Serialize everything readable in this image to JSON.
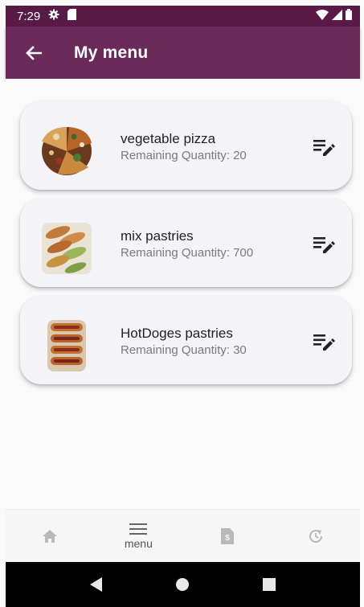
{
  "status_bar": {
    "time": "7:29"
  },
  "app_bar": {
    "title": "My menu"
  },
  "menu_items": [
    {
      "name": "vegetable pizza",
      "remaining": "Remaining Quantity: 20"
    },
    {
      "name": "mix pastries",
      "remaining": "Remaining Quantity: 700"
    },
    {
      "name": "HotDoges pastries",
      "remaining": "Remaining Quantity: 30"
    }
  ],
  "bottom_nav": {
    "items": [
      {
        "icon": "home-icon",
        "label": ""
      },
      {
        "icon": "menu-icon",
        "label": "menu"
      },
      {
        "icon": "invoice-icon",
        "label": ""
      },
      {
        "icon": "history-icon",
        "label": ""
      }
    ]
  },
  "colors": {
    "app_bar": "#6a2a5a",
    "status_bar": "#5a1a47",
    "card_bg": "#f4f4f8"
  }
}
